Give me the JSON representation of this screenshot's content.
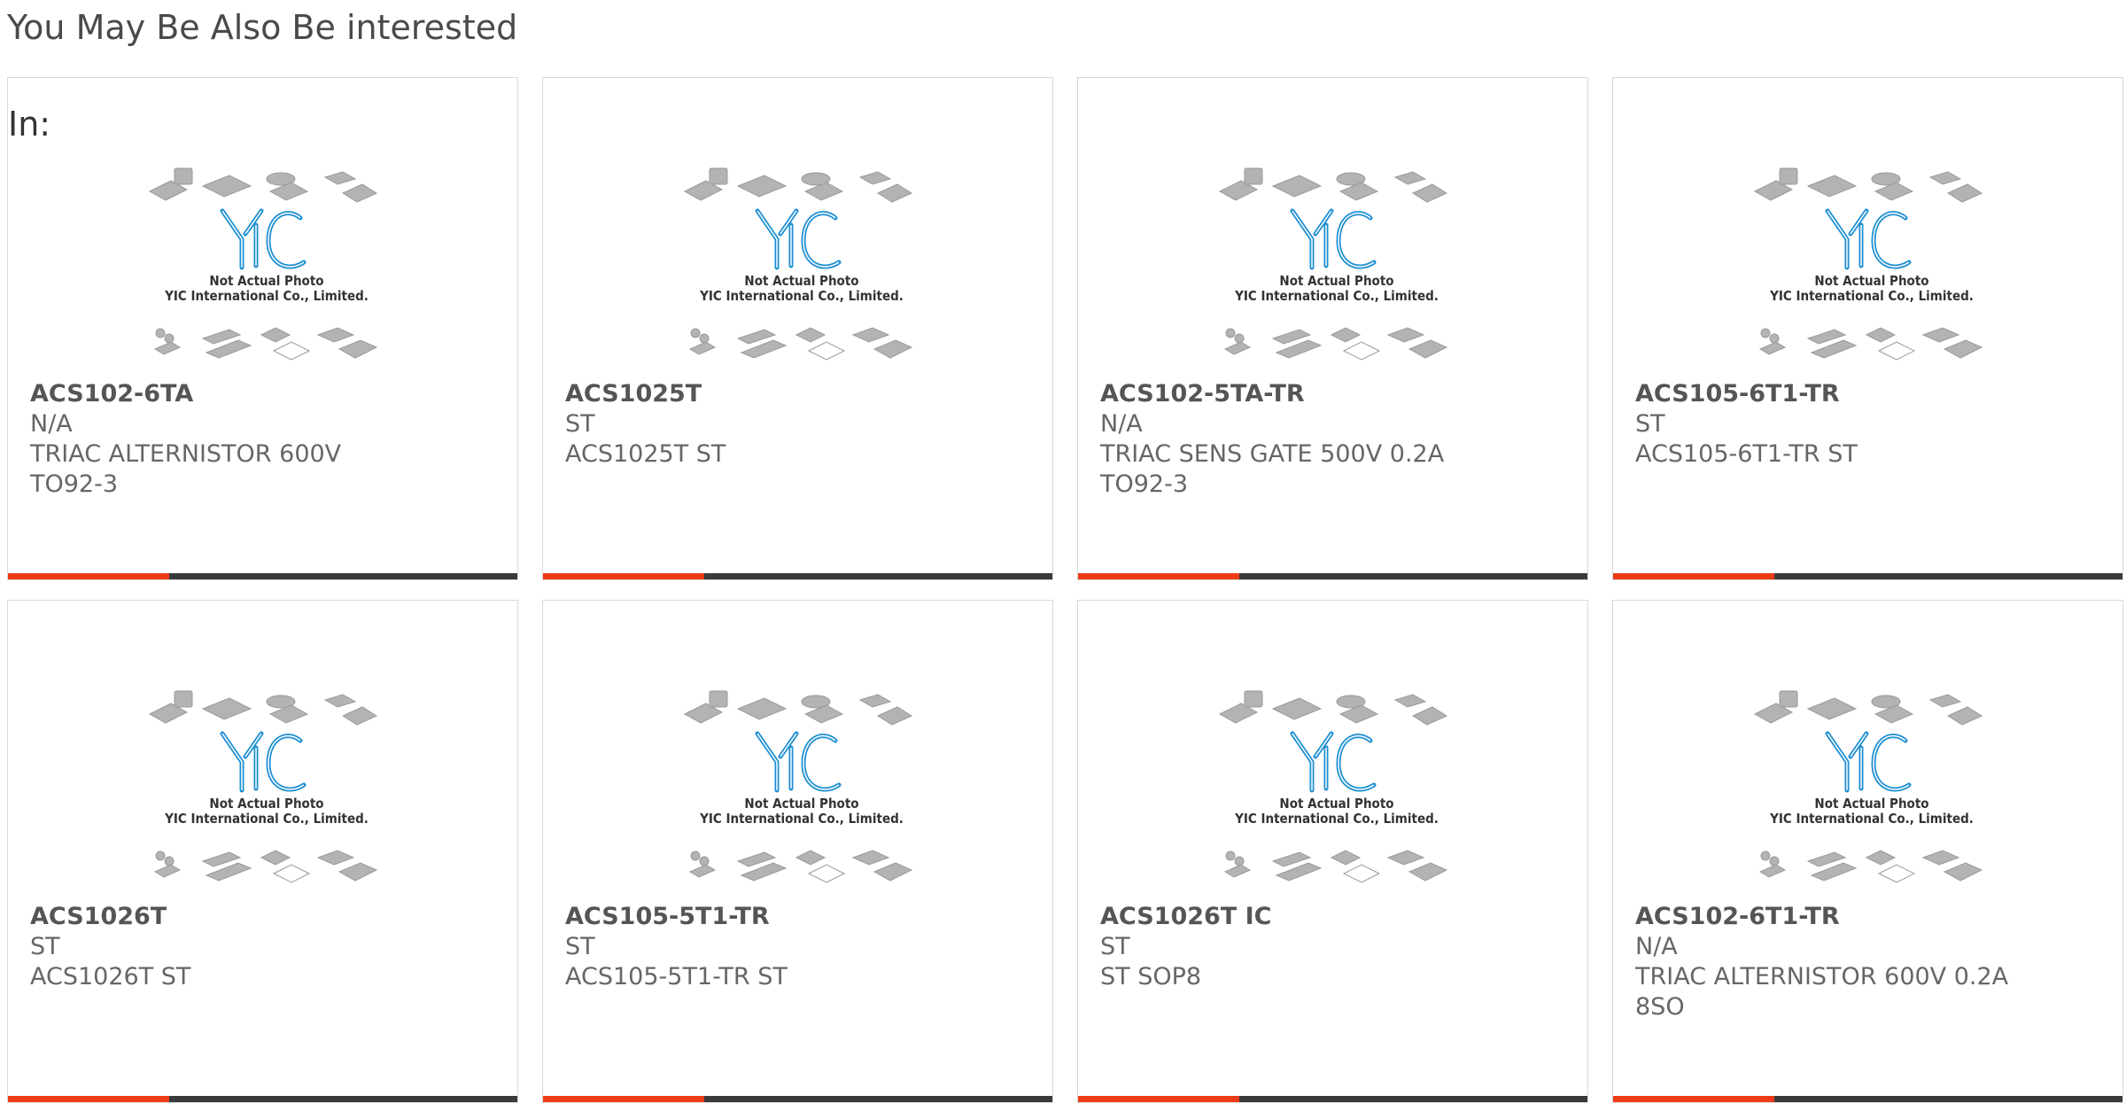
{
  "section": {
    "title": "You May Be Also Be interested",
    "title_continued": "In:"
  },
  "colors": {
    "accent": "#ee3b17",
    "bar": "#3a3a3a",
    "logo_blue": "#1d8fd2"
  },
  "placeholder": {
    "line1": "Not Actual Photo",
    "line2": "YIC International Co., Limited.",
    "logo": "YIC"
  },
  "products": [
    {
      "part": "ACS102-6TA",
      "mfr": "N/A",
      "desc_lines": [
        "TRIAC ALTERNISTOR 600V",
        "TO92-3"
      ]
    },
    {
      "part": "ACS1025T",
      "mfr": "ST",
      "desc_lines": [
        "ACS1025T ST"
      ]
    },
    {
      "part": "ACS102-5TA-TR",
      "mfr": "N/A",
      "desc_lines": [
        "TRIAC SENS GATE 500V 0.2A",
        "TO92-3"
      ]
    },
    {
      "part": "ACS105-6T1-TR",
      "mfr": "ST",
      "desc_lines": [
        "ACS105-6T1-TR ST"
      ]
    },
    {
      "part": "ACS1026T",
      "mfr": "ST",
      "desc_lines": [
        "ACS1026T ST"
      ]
    },
    {
      "part": "ACS105-5T1-TR",
      "mfr": "ST",
      "desc_lines": [
        "ACS105-5T1-TR ST"
      ]
    },
    {
      "part": "ACS1026T IC",
      "mfr": "ST",
      "desc_lines": [
        "ST SOP8"
      ]
    },
    {
      "part": "ACS102-6T1-TR",
      "mfr": "N/A",
      "desc_lines": [
        "TRIAC ALTERNISTOR 600V 0.2A",
        "8SO"
      ]
    }
  ]
}
